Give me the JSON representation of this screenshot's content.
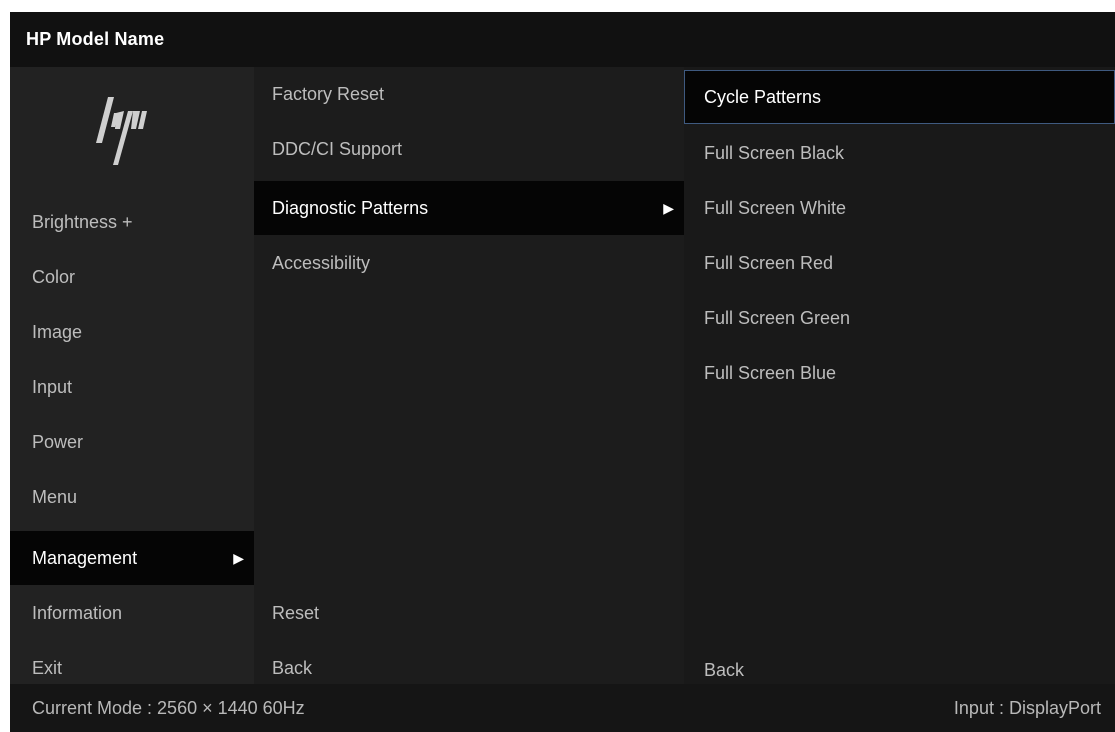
{
  "window": {
    "title": "HP Model Name"
  },
  "logo": {
    "icon": "hp-logo-icon"
  },
  "main_menu": {
    "items": [
      {
        "label": "Brightness +"
      },
      {
        "label": "Color"
      },
      {
        "label": "Image"
      },
      {
        "label": "Input"
      },
      {
        "label": "Power"
      },
      {
        "label": "Menu"
      },
      {
        "label": "Management",
        "selected": true
      },
      {
        "label": "Information"
      },
      {
        "label": "Exit"
      }
    ]
  },
  "management_menu": {
    "items": [
      {
        "label": "Factory Reset"
      },
      {
        "label": "DDC/CI Support"
      },
      {
        "label": "Diagnostic Patterns",
        "selected": true
      },
      {
        "label": "Accessibility"
      }
    ],
    "reset_label": "Reset",
    "back_label": "Back"
  },
  "patterns_menu": {
    "items": [
      {
        "label": "Cycle Patterns",
        "focused": true
      },
      {
        "label": "Full Screen Black"
      },
      {
        "label": "Full Screen White"
      },
      {
        "label": "Full Screen Red"
      },
      {
        "label": "Full Screen Green"
      },
      {
        "label": "Full Screen Blue"
      }
    ],
    "back_label": "Back"
  },
  "arrow_glyph": "▶",
  "status": {
    "mode": "Current Mode : 2560 × 1440  60Hz",
    "input": "Input : DisplayPort"
  },
  "colors": {
    "background": "#1f1f1f",
    "title_bar": "#111111",
    "selected_row": "#050505",
    "focus_outline": "#3f5a80",
    "text": "#bdbdbd",
    "text_selected": "#ffffff"
  }
}
